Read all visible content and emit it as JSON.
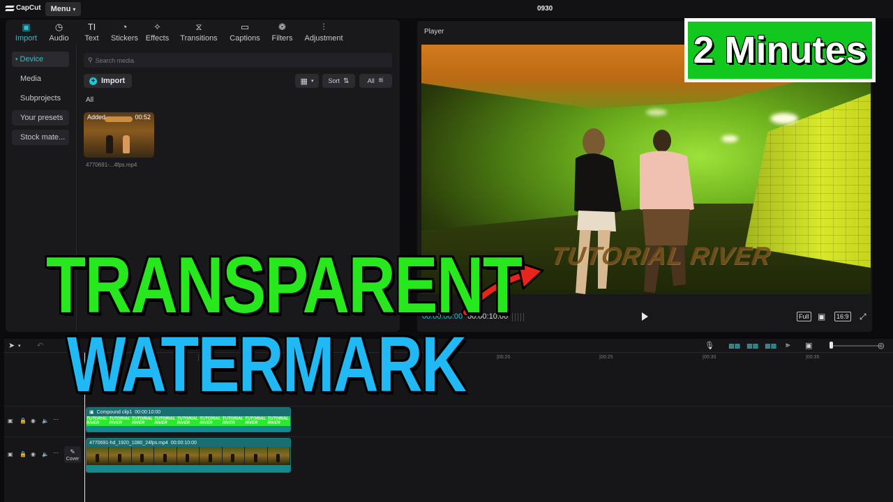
{
  "app": {
    "logo": "CapCut",
    "menu_label": "Menu",
    "project_title": "0930"
  },
  "tabs": [
    {
      "label": "Import",
      "icon": "import-icon",
      "glyph": "▣"
    },
    {
      "label": "Audio",
      "icon": "audio-icon",
      "glyph": "◷"
    },
    {
      "label": "Text",
      "icon": "text-icon",
      "glyph": "TI"
    },
    {
      "label": "Stickers",
      "icon": "stickers-icon",
      "glyph": "◔"
    },
    {
      "label": "Effects",
      "icon": "effects-icon",
      "glyph": "✧"
    },
    {
      "label": "Transitions",
      "icon": "transitions-icon",
      "glyph": "⧖"
    },
    {
      "label": "Captions",
      "icon": "captions-icon",
      "glyph": "▭"
    },
    {
      "label": "Filters",
      "icon": "filters-icon",
      "glyph": "❁"
    },
    {
      "label": "Adjustment",
      "icon": "adjustment-icon",
      "glyph": "⫶"
    }
  ],
  "sidebar": {
    "items": [
      {
        "label": "Device"
      },
      {
        "label": "Media"
      },
      {
        "label": "Subprojects"
      },
      {
        "label": "Your presets"
      },
      {
        "label": "Stock mate..."
      }
    ]
  },
  "media": {
    "search_placeholder": "Search media",
    "import_label": "Import",
    "sort_label": "Sort",
    "filter_label": "All",
    "section_label": "All",
    "item": {
      "badge": "Added",
      "duration": "00:52",
      "file_name": "4770691-...4fps.mp4"
    }
  },
  "player": {
    "label": "Player",
    "watermark_text": "TUTORIAL RIVER",
    "current_time": "00:00:00:00",
    "total_time": "00:00:10:00",
    "full_label": "Full",
    "ratio_label": "16:9"
  },
  "timeline": {
    "ruler": [
      "05",
      "|00:20",
      "|00:25",
      "|00:30",
      "|00:35"
    ],
    "compound_clip": {
      "name": "Compound clip1",
      "duration": "00:00:10:00",
      "repeat_text": "TUTORIAL RIVER"
    },
    "video_clip": {
      "name": "4770691-hd_1920_1080_24fps.mp4",
      "duration": "00:00:10:00"
    },
    "cover_label": "Cover"
  },
  "overlay": {
    "duration_badge": "2 Minutes",
    "headline_line1": "TRANSPARENT",
    "headline_line2": "WATERMARK"
  },
  "colors": {
    "accent": "#23c4d4",
    "headline_green": "#27e81c",
    "headline_blue": "#20b8f5",
    "badge_green": "#10c81e",
    "arrow_red": "#e8241c"
  }
}
